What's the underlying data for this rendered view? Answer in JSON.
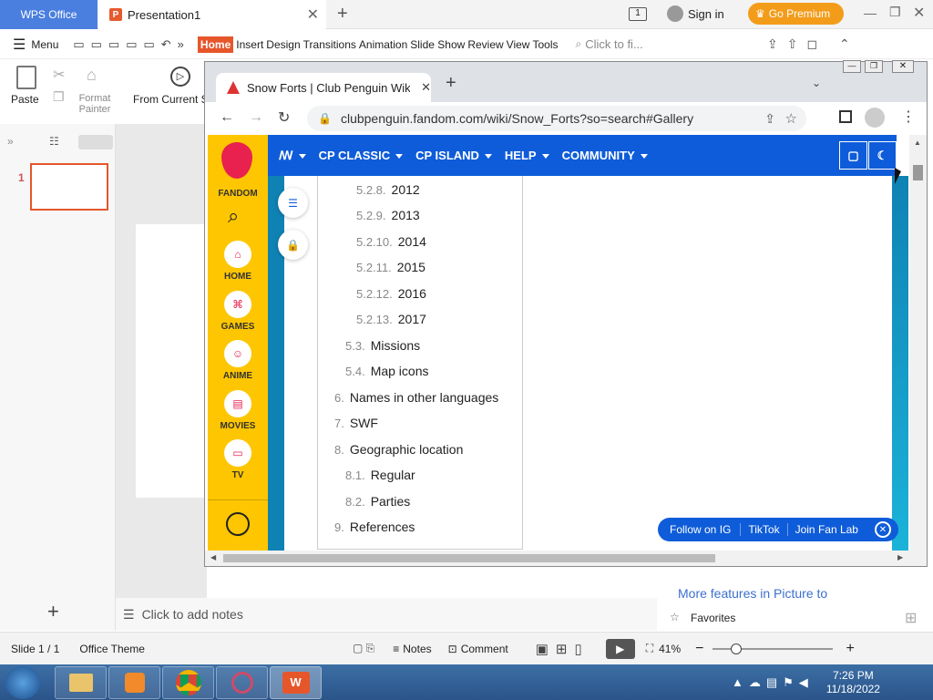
{
  "wps": {
    "home_tab": "WPS Office",
    "doc_tab": "Presentation1",
    "sign_in": "Sign in",
    "go_premium": "Go Premium",
    "menu": "Menu",
    "ribbon_tabs": [
      "Home",
      "Insert",
      "Design",
      "Transitions",
      "Animation",
      "Slide Show",
      "Review",
      "View",
      "Tools"
    ],
    "search": "Click to fi...",
    "paste": "Paste",
    "format_painter": "Format Painter",
    "from_current": "From Current S",
    "slide_number": "1",
    "notes_placeholder": "Click to add notes",
    "more_features": "More features in Picture to",
    "favorites": "Favorites",
    "status": {
      "slide": "Slide 1 / 1",
      "theme": "Office Theme",
      "notes": "Notes",
      "comment": "Comment",
      "zoom": "41%"
    }
  },
  "chrome": {
    "tab_title": "Snow Forts | Club Penguin Wiki |",
    "url": "clubpenguin.fandom.com/wiki/Snow_Forts?so=search#Gallery"
  },
  "fandom": {
    "logo": "FANDOM",
    "rail": [
      "HOME",
      "GAMES",
      "ANIME",
      "MOVIES",
      "TV"
    ],
    "nav": [
      "CP CLASSIC",
      "CP ISLAND",
      "HELP",
      "COMMUNITY"
    ],
    "toc": [
      {
        "num": "5.2.8.",
        "label": "2012"
      },
      {
        "num": "5.2.9.",
        "label": "2013"
      },
      {
        "num": "5.2.10.",
        "label": "2014"
      },
      {
        "num": "5.2.11.",
        "label": "2015"
      },
      {
        "num": "5.2.12.",
        "label": "2016"
      },
      {
        "num": "5.2.13.",
        "label": "2017"
      },
      {
        "num": "5.3.",
        "label": "Missions"
      },
      {
        "num": "5.4.",
        "label": "Map icons"
      },
      {
        "num": "6.",
        "label": "Names in other languages"
      },
      {
        "num": "7.",
        "label": "SWF"
      },
      {
        "num": "8.",
        "label": "Geographic location"
      },
      {
        "num": "8.1.",
        "label": "Regular"
      },
      {
        "num": "8.2.",
        "label": "Parties"
      },
      {
        "num": "9.",
        "label": "References"
      }
    ],
    "fanbar": [
      "Follow on IG",
      "TikTok",
      "Join Fan Lab"
    ]
  },
  "taskbar": {
    "time": "7:26 PM",
    "date": "11/18/2022"
  }
}
